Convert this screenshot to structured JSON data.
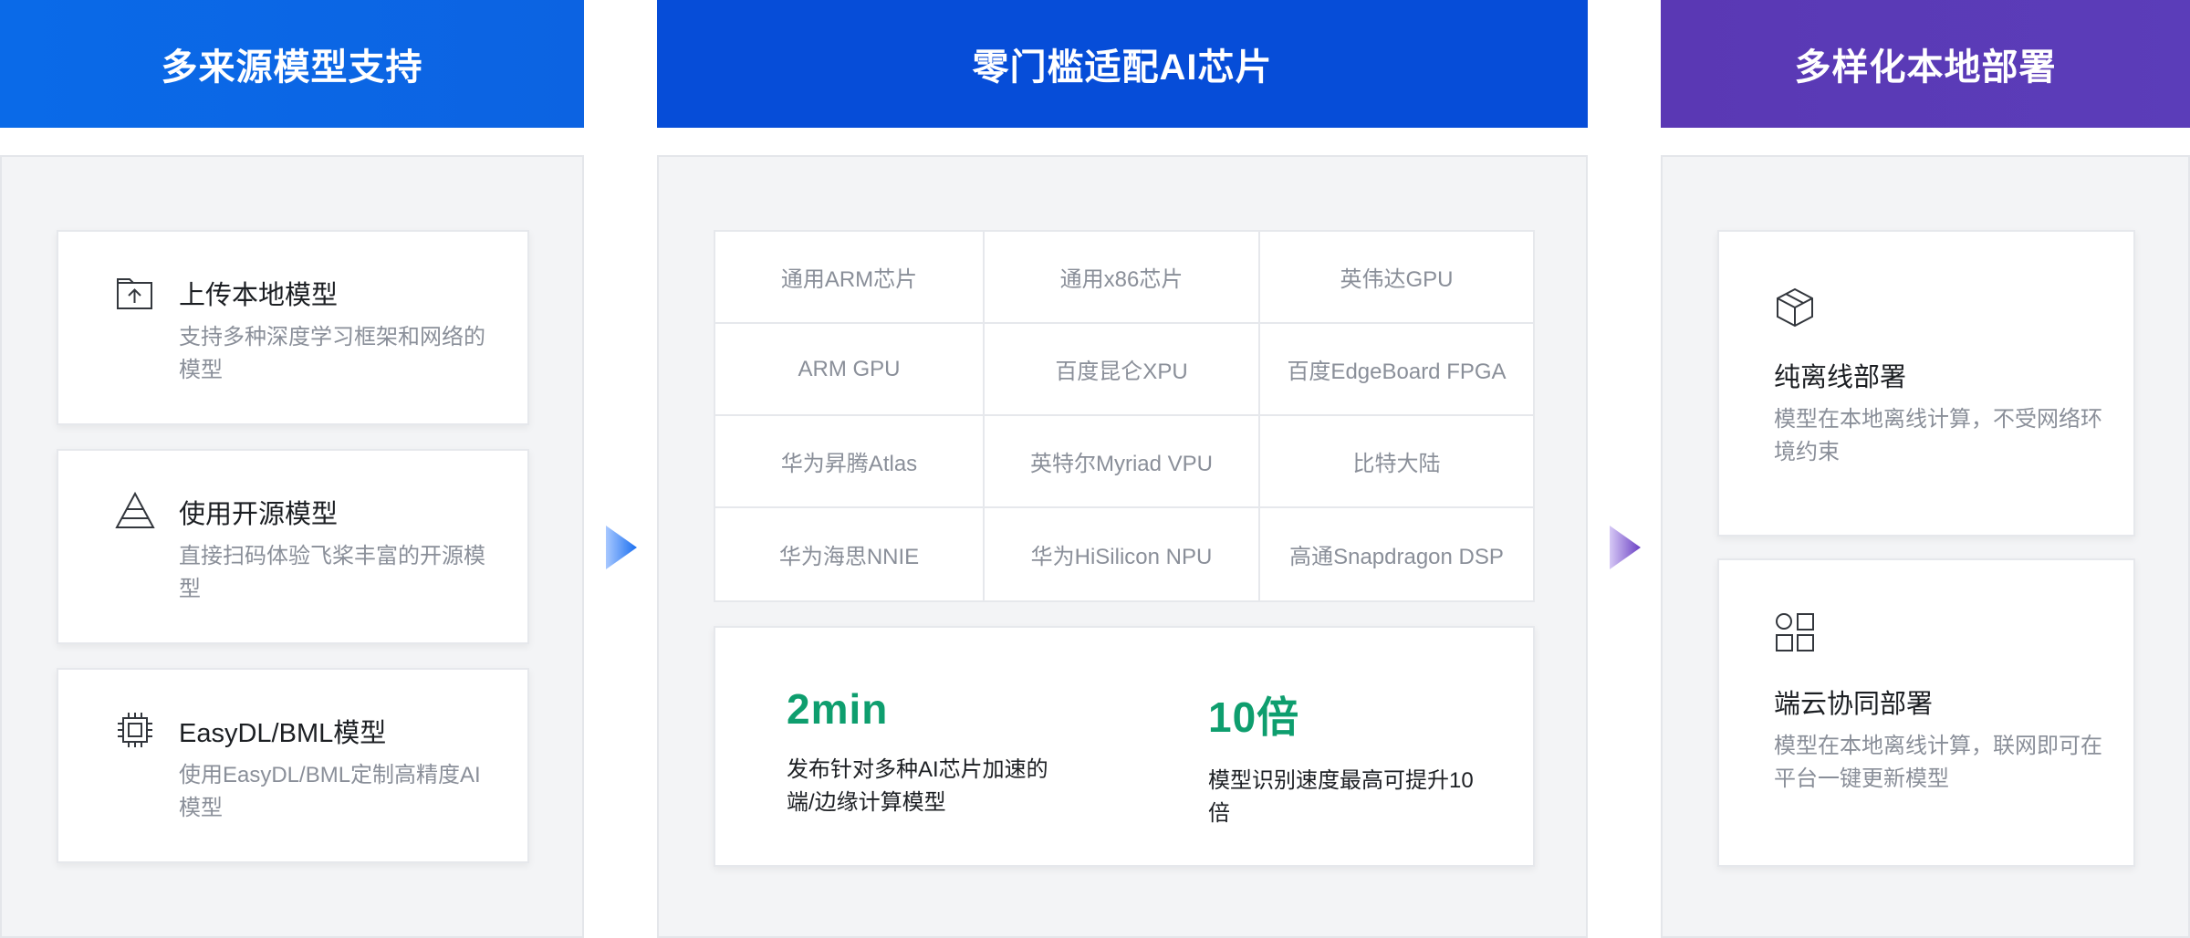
{
  "columns": {
    "sources": {
      "title": "多来源模型支持",
      "items": [
        {
          "icon": "folder-upload-icon",
          "title": "上传本地模型",
          "desc": "支持多种深度学习框架和网络的模型"
        },
        {
          "icon": "pyramid-layers-icon",
          "title": "使用开源模型",
          "desc": "直接扫码体验飞桨丰富的开源模型"
        },
        {
          "icon": "chip-icon",
          "title": "EasyDL/BML模型",
          "desc": "使用EasyDL/BML定制高精度AI模型"
        }
      ]
    },
    "chips": {
      "title": "零门槛适配AI芯片",
      "grid": [
        "通用ARM芯片",
        "通用x86芯片",
        "英伟达GPU",
        "ARM GPU",
        "百度昆仑XPU",
        "百度EdgeBoard FPGA",
        "华为昇腾Atlas",
        "英特尔Myriad VPU",
        "比特大陆",
        "华为海思NNIE",
        "华为HiSilicon NPU",
        "高通Snapdragon DSP"
      ],
      "stats": [
        {
          "value": "2min",
          "desc": "发布针对多种AI芯片加速的端/边缘计算模型"
        },
        {
          "value": "10倍",
          "desc": "模型识别速度最高可提升10倍"
        }
      ]
    },
    "deploy": {
      "title": "多样化本地部署",
      "items": [
        {
          "icon": "cube-icon",
          "title": "纯离线部署",
          "desc": "模型在本地离线计算，不受网络环境约束"
        },
        {
          "icon": "grid-apps-icon",
          "title": "端云协同部署",
          "desc": "模型在本地离线计算，联网即可在平台一键更新模型"
        }
      ]
    }
  },
  "colors": {
    "header_blue": "#0a6ae8",
    "header_deep_blue": "#064dd8",
    "header_purple": "#5a38b4",
    "stat_green": "#0e9e6e"
  }
}
